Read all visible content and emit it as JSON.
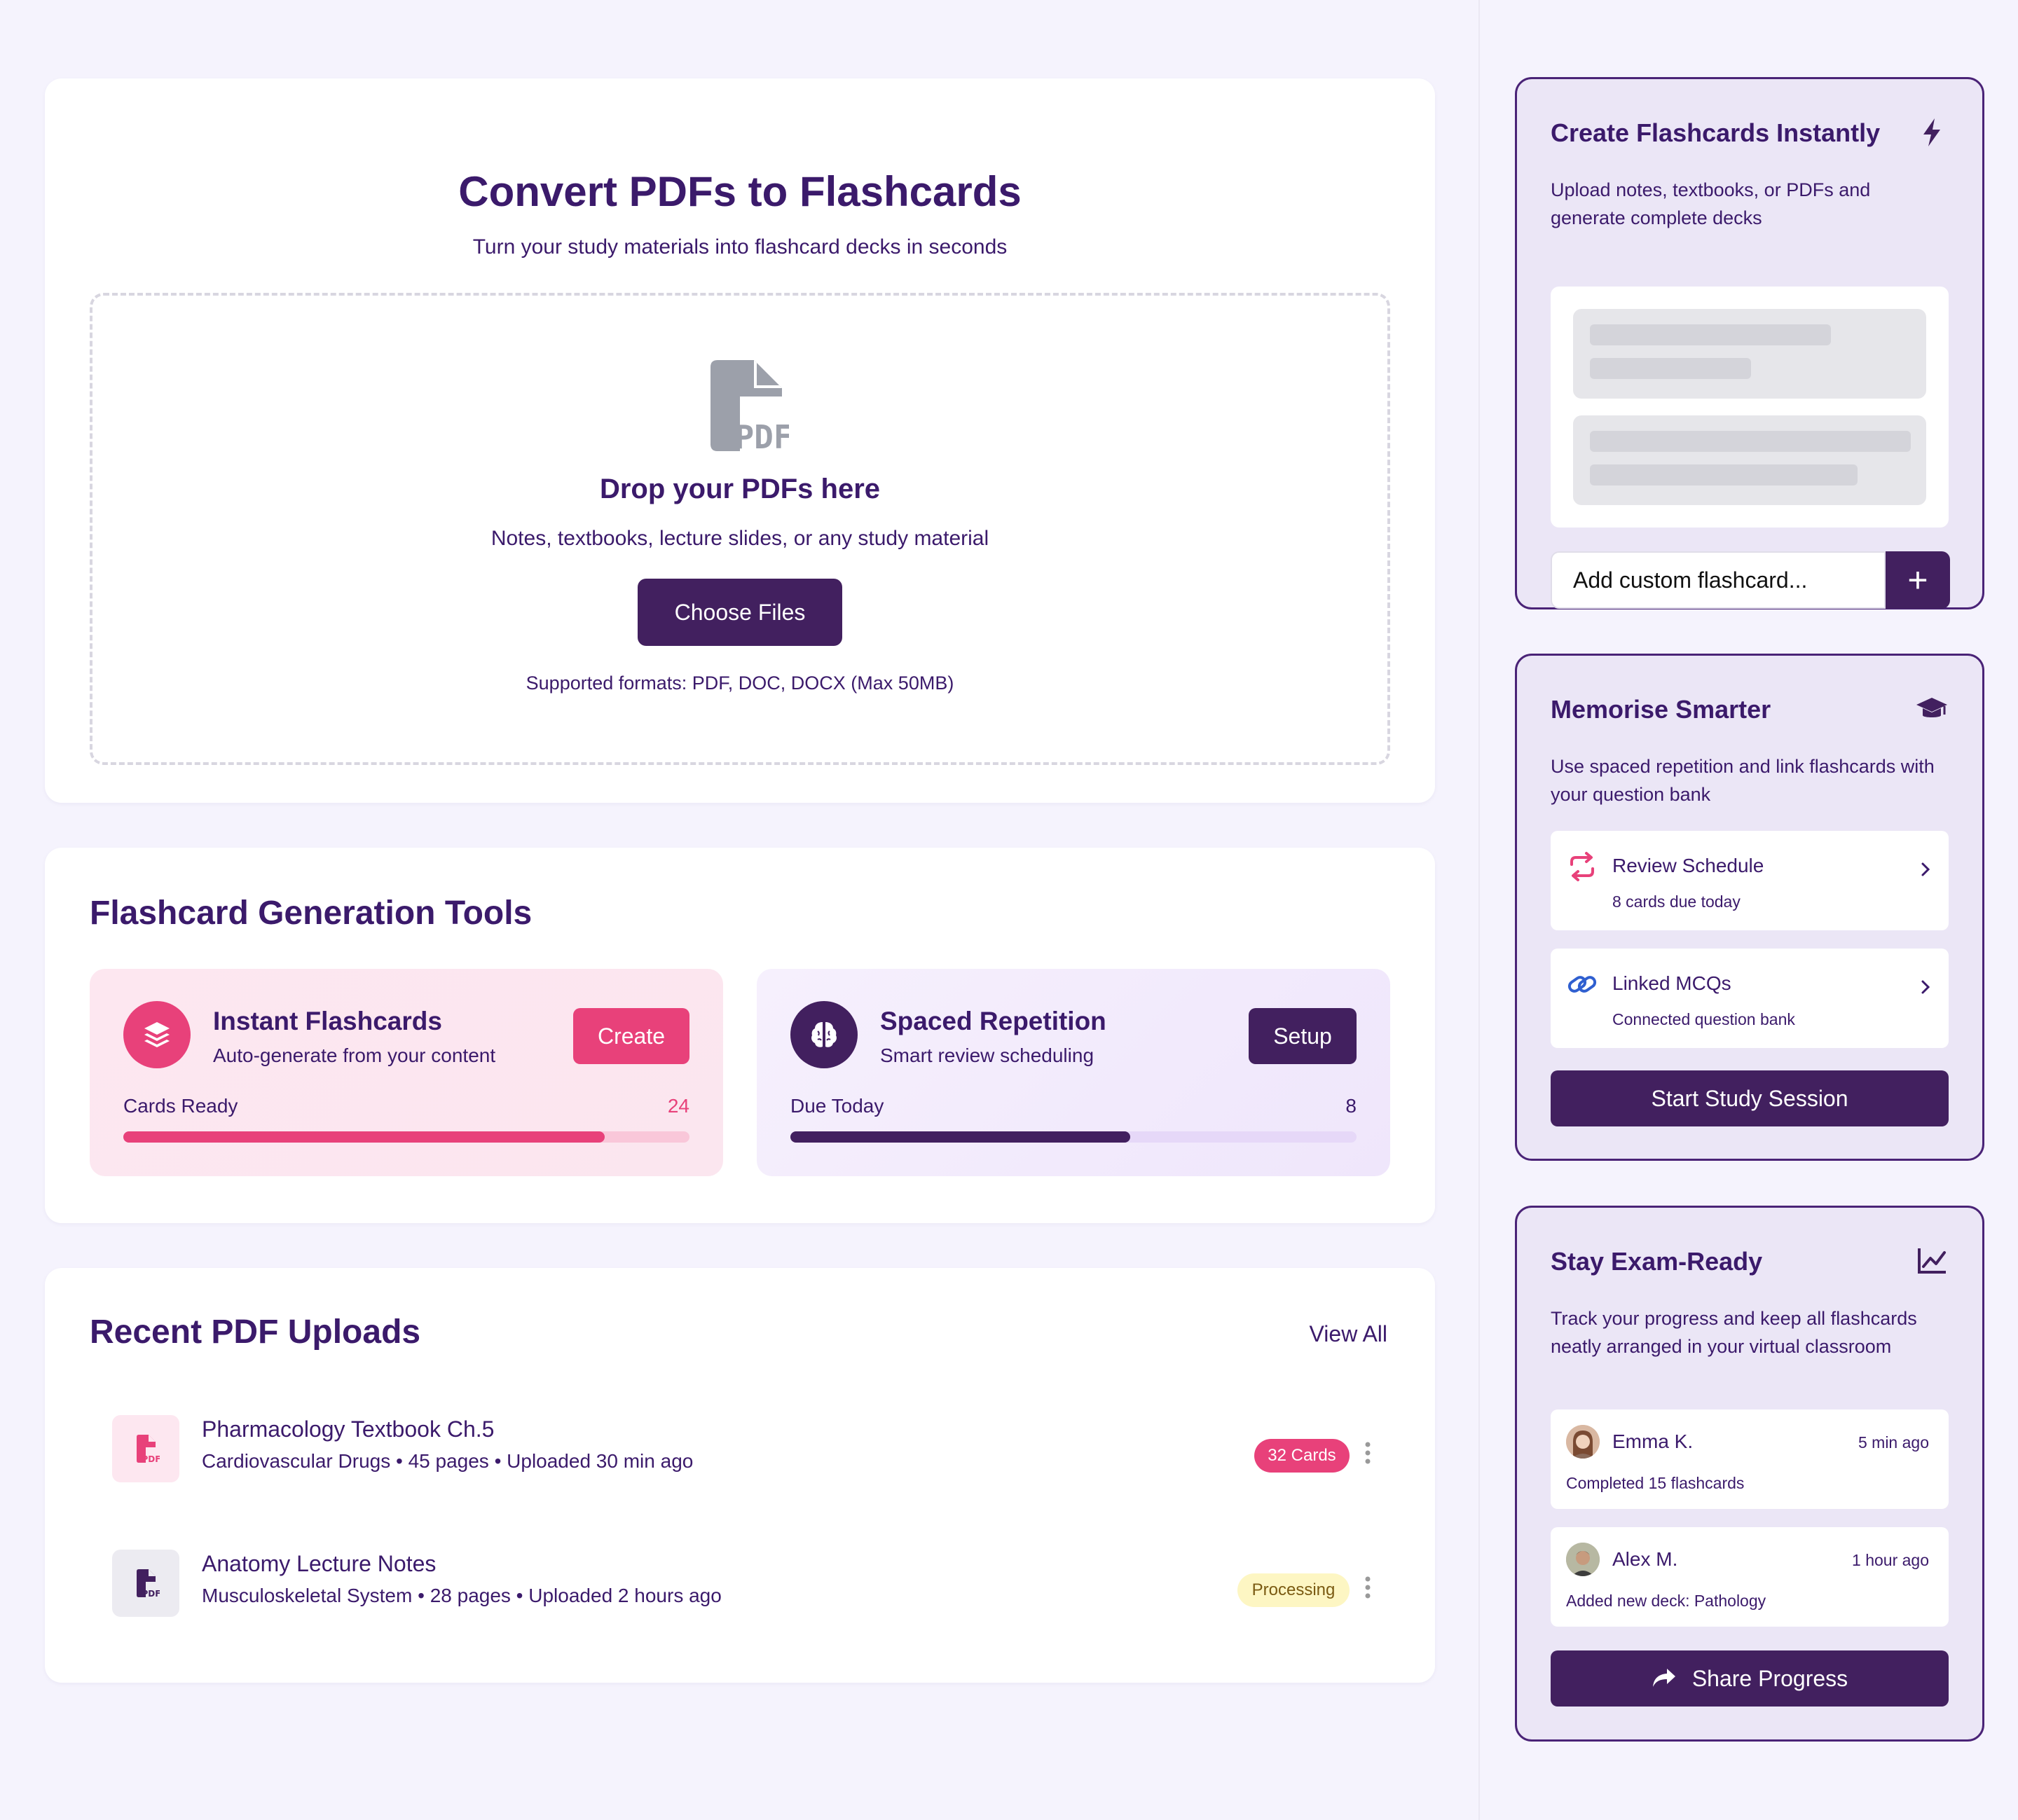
{
  "upload": {
    "title": "Convert PDFs to Flashcards",
    "subtitle": "Turn your study materials into flashcard decks in seconds",
    "drop_title": "Drop your PDFs here",
    "drop_subtitle": "Notes, textbooks, lecture slides, or any study material",
    "choose_button": "Choose Files",
    "formats": "Supported formats: PDF, DOC, DOCX (Max 50MB)",
    "icon_label": "PDF"
  },
  "tools": {
    "title": "Flashcard Generation Tools",
    "items": [
      {
        "name": "Instant Flashcards",
        "description": "Auto-generate from your content",
        "button": "Create",
        "stat_label": "Cards Ready",
        "stat_value": "24",
        "progress": 0.85,
        "accent": "#e8417a",
        "icon": "layers-icon"
      },
      {
        "name": "Spaced Repetition",
        "description": "Smart review scheduling",
        "button": "Setup",
        "stat_label": "Due Today",
        "stat_value": "8",
        "progress": 0.6,
        "accent": "#42205f",
        "icon": "brain-icon"
      }
    ]
  },
  "recent": {
    "title": "Recent PDF Uploads",
    "view_all": "View All",
    "files": [
      {
        "name": "Pharmacology Textbook Ch.5",
        "meta": "Cardiovascular Drugs • 45 pages • Uploaded 30 min ago",
        "badge": "32 Cards",
        "badge_color": "#e8417a"
      },
      {
        "name": "Anatomy Lecture Notes",
        "meta": "Musculoskeletal System • 28 pages • Uploaded 2 hours ago",
        "badge": "Processing",
        "badge_color": "#fdf6c3"
      }
    ]
  },
  "panel_create": {
    "title": "Create Flashcards Instantly",
    "description": "Upload notes, textbooks, or PDFs and generate complete decks",
    "input_placeholder": "Add custom flashcard...",
    "add_button": "+",
    "icon": "bolt-icon"
  },
  "panel_memorise": {
    "title": "Memorise Smarter",
    "description": "Use spaced repetition and link flashcards with your question bank",
    "icon": "graduation-cap-icon",
    "links": [
      {
        "label": "Review Schedule",
        "sub": "8 cards due today",
        "icon": "repeat-icon"
      },
      {
        "label": "Linked MCQs",
        "sub": "Connected question bank",
        "icon": "link-icon"
      }
    ],
    "button": "Start Study Session"
  },
  "panel_exam": {
    "title": "Stay Exam-Ready",
    "description": "Track your progress and keep all flashcards neatly arranged in your virtual classroom",
    "icon": "chart-line-icon",
    "activity": [
      {
        "name": "Emma K.",
        "time": "5 min ago",
        "desc": "Completed 15 flashcards"
      },
      {
        "name": "Alex M.",
        "time": "1 hour ago",
        "desc": "Added new deck: Pathology"
      }
    ],
    "button": "Share Progress"
  },
  "colors": {
    "primary": "#42205f",
    "accent_pink": "#e8417a",
    "text": "#3b1a6b",
    "background": "#f5f3fd"
  }
}
